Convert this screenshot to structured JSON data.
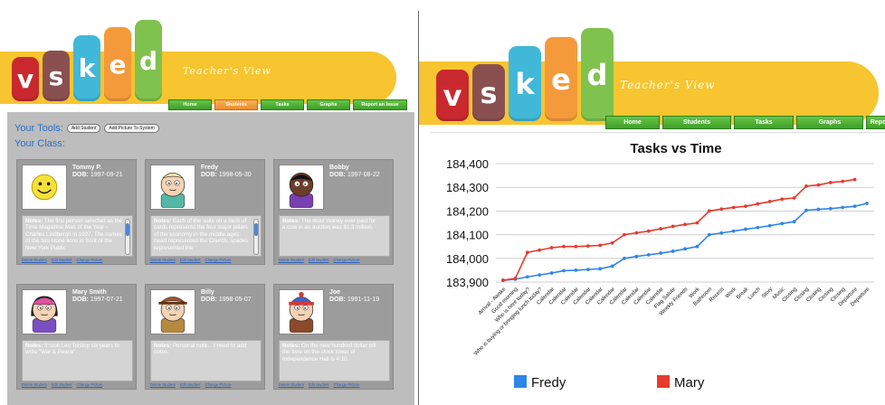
{
  "app": {
    "logo_letters": [
      "v",
      "s",
      "k",
      "e",
      "d"
    ],
    "logo_colors": [
      "#c9292e",
      "#8a5050",
      "#41b8d8",
      "#f59a3b",
      "#80c24e"
    ],
    "tagline": "Teacher's View",
    "banner_color": "#f7c530"
  },
  "left_view": {
    "nav": [
      "Home",
      "Students",
      "Tasks",
      "Graphs",
      "Report an Issue"
    ],
    "active_tab": "Students",
    "tools_label": "Your Tools:",
    "add_student_label": "Add Student",
    "add_picture_label": "Add Picture To System",
    "class_label": "Your Class:",
    "students": [
      {
        "name": "Tommy P.",
        "dob_label": "DOB:",
        "dob": "1997-09-21",
        "avatar": "smiley-icon",
        "notes_label": "Notes:",
        "notes": "The first person selected as the Time Magazine Man of the Year - Charles Lindbergh in 1927. The names of the two stone lions in front of the New York Public",
        "has_scroll": true,
        "links": [
          "Delete Student",
          "Edit Student",
          "Change Picture"
        ]
      },
      {
        "name": "Fredy",
        "dob_label": "DOB:",
        "dob": "1998-05-30",
        "avatar": "butters-avatar-icon",
        "notes_label": "Notes:",
        "notes": "Each of the suits on a deck of cards represents the four major pillars of the economy in the middle ages: heart represented the Church, spades represented the",
        "has_scroll": true,
        "links": [
          "Delete Student",
          "Edit Student",
          "Change Picture"
        ]
      },
      {
        "name": "Bobby",
        "dob_label": "DOB:",
        "dob": "1997-08-22",
        "avatar": "token-avatar-icon",
        "notes_label": "Notes:",
        "notes": "The most money ever paid for a cow in an auction was $1.3 million.",
        "has_scroll": false,
        "links": [
          "Delete Student",
          "Edit Student",
          "Change Picture"
        ]
      },
      {
        "name": "Mary Smith",
        "dob_label": "DOB:",
        "dob": "1997-07-21",
        "avatar": "wendy-avatar-icon",
        "notes_label": "Notes:",
        "notes": "It took Leo Tolstoy six years to write \"War & Peace\".",
        "has_scroll": false,
        "links": [
          "Delete Student",
          "Edit Student",
          "Change Picture"
        ]
      },
      {
        "name": "Billy",
        "dob_label": "DOB:",
        "dob": "1998-05-07",
        "avatar": "pip-avatar-icon",
        "notes_label": "Notes:",
        "notes": "Personal note... I need to add notes.",
        "has_scroll": false,
        "links": [
          "Delete Student",
          "Edit Student",
          "Change Picture"
        ]
      },
      {
        "name": "Joe",
        "dob_label": "DOB:",
        "dob": "1991-11-19",
        "avatar": "stan-avatar-icon",
        "notes_label": "Notes:",
        "notes": "On the new hundred dollar bill the time on the clock tower of Independence Hall is 4:10.",
        "has_scroll": false,
        "links": [
          "Delete Student",
          "Edit Student",
          "Change Picture"
        ]
      }
    ]
  },
  "right_view": {
    "nav": [
      "Home",
      "Students",
      "Tasks",
      "Graphs",
      "Report an Issue"
    ],
    "active_tab": ""
  },
  "chart_data": {
    "type": "line",
    "title": "Tasks vs Time",
    "xlabel": "",
    "ylabel": "",
    "ylim": [
      183900,
      184400
    ],
    "yticks": [
      183900,
      184000,
      184100,
      184200,
      184300,
      184400
    ],
    "y_tick_labels": [
      "183,900",
      "184,000",
      "184,100",
      "184,200",
      "184,300",
      "184,400"
    ],
    "grid": true,
    "legend_position": "bottom",
    "categories": [
      "Arrival - Awake",
      "Good morning",
      "Who is here today?",
      "Who is buying or bringing lunch today?",
      "Calendar",
      "Calendar",
      "Calendar",
      "Calendar",
      "Calendar",
      "Calendar",
      "Calendar",
      "Calendar",
      "Calendar",
      "Calendar",
      "Flag Salute",
      "Weekly Friends",
      "Work",
      "Bathroom",
      "Recess",
      "Work",
      "Break",
      "Lunch",
      "Story",
      "Music",
      "Closing",
      "Closing",
      "Closing",
      "Closing",
      "Closing",
      "Departure",
      "Departure"
    ],
    "series": [
      {
        "name": "Fredy",
        "color": "#2f86e8",
        "values": [
          183907,
          183912,
          183922,
          183930,
          183938,
          183948,
          183950,
          183953,
          183956,
          183967,
          184000,
          184008,
          184015,
          184022,
          184030,
          184040,
          184050,
          184100,
          184107,
          184115,
          184123,
          184130,
          184138,
          184147,
          184155,
          184203,
          184207,
          184210,
          184215,
          184220,
          184232
        ]
      },
      {
        "name": "Mary",
        "color": "#e63b2e",
        "values": [
          183908,
          183915,
          184025,
          184035,
          184045,
          184050,
          184050,
          184052,
          184055,
          184065,
          184100,
          184108,
          184115,
          184125,
          184135,
          184143,
          184150,
          184200,
          184208,
          184215,
          184220,
          184230,
          184240,
          184250,
          184255,
          184305,
          184310,
          184320,
          184325,
          184333,
          null
        ]
      }
    ]
  }
}
